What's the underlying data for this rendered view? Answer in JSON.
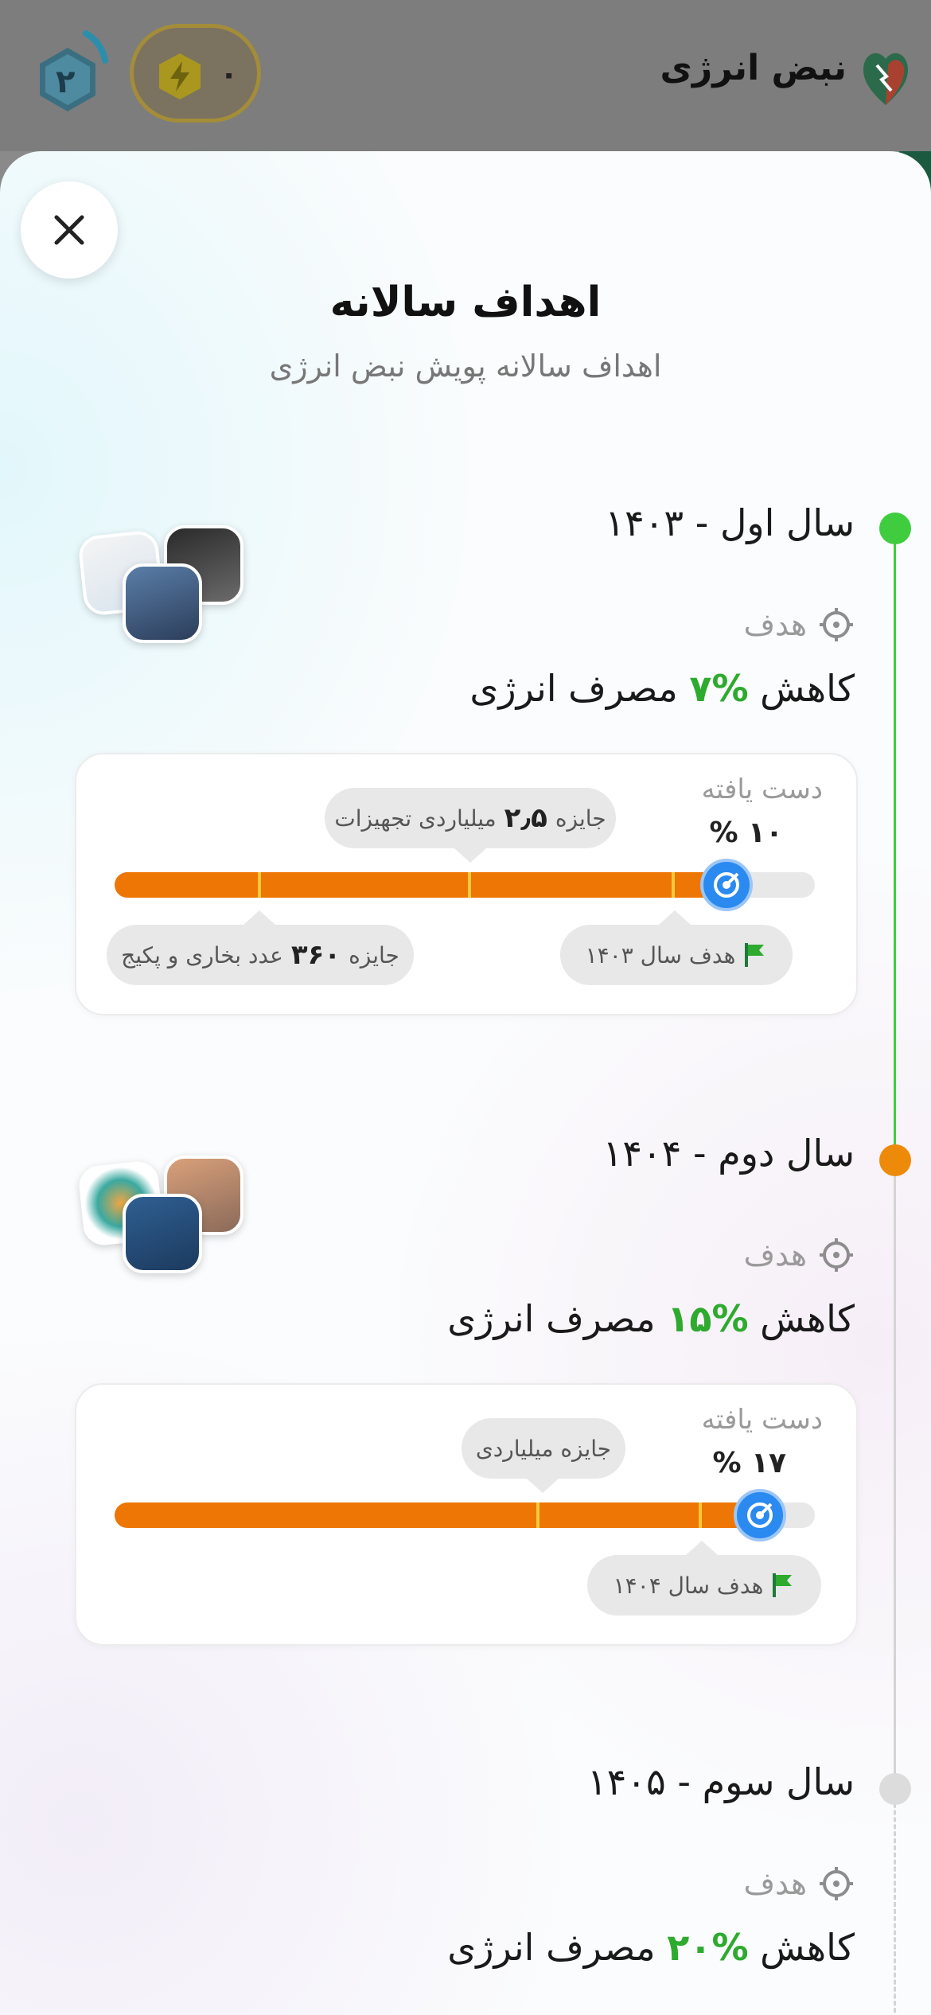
{
  "app": {
    "title": "نبض انرژی",
    "coins": "۰",
    "level": "۲"
  },
  "colors": {
    "accent_orange": "#ee7605",
    "achieved_green": "#3fcd3f",
    "pct_green": "#2eaa2e",
    "knob_blue": "#2a8af0",
    "pending_gray": "#d9d9d9"
  },
  "sheet": {
    "title": "اهداف سالانه",
    "subtitle": "اهداف سالانه پویش نبض انرژی"
  },
  "goal_label": "هدف",
  "years": [
    {
      "title": "سال اول - ۱۴۰۳",
      "status": "done",
      "goal": {
        "prefix": "کاهش",
        "pct": "%۷",
        "suffix": "مصرف انرژی"
      },
      "progress": {
        "achieved_label": "دست یافته",
        "achieved_value": "۱۰ %",
        "fill_fraction": 0.87,
        "top_bubble": {
          "before": "جایزه",
          "bold": "۲٫۵",
          "after": "میلیاردی تجهیزات"
        },
        "bottom_left_bubble": {
          "before": "جایزه",
          "bold": "۳۶۰",
          "after": "عدد بخاری و پکیج"
        },
        "target_flag": "هدف سال ۱۴۰۳"
      }
    },
    {
      "title": "سال دوم - ۱۴۰۴",
      "status": "current",
      "goal": {
        "prefix": "کاهش",
        "pct": "%۱۵",
        "suffix": "مصرف انرژی"
      },
      "progress": {
        "achieved_label": "دست یافته",
        "achieved_value": "۱۷ %",
        "fill_fraction": 0.92,
        "top_bubble": {
          "before": "جایزه میلیاردی"
        },
        "target_flag": "هدف سال ۱۴۰۴"
      }
    },
    {
      "title": "سال سوم - ۱۴۰۵",
      "status": "upcoming",
      "goal": {
        "prefix": "کاهش",
        "pct": "%۲۰",
        "suffix": "مصرف انرژی"
      }
    }
  ]
}
